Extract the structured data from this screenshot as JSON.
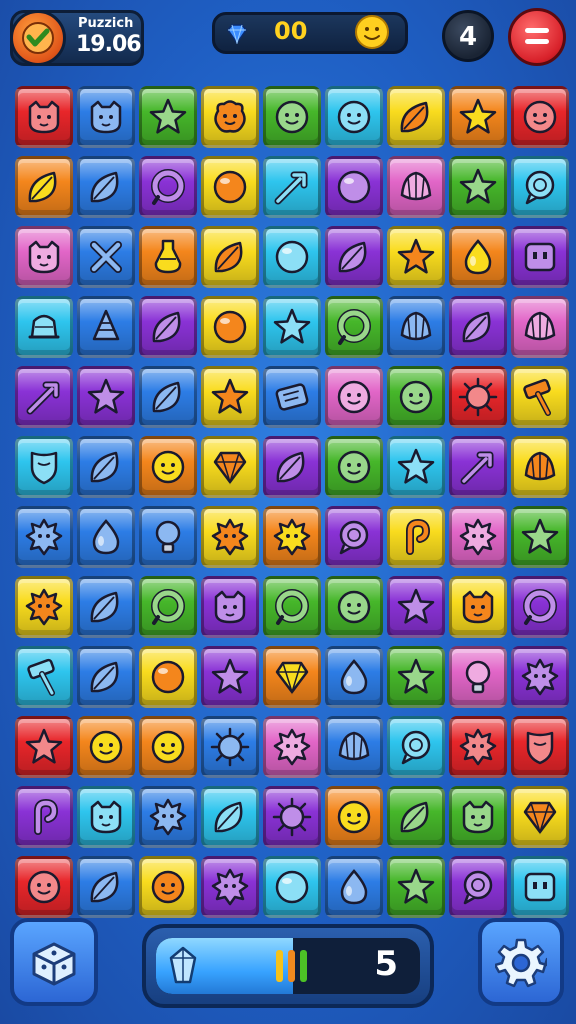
{
  "header": {
    "title": "Puzzich",
    "score": "19.06",
    "gems": "00",
    "lives": "4"
  },
  "footer": {
    "moves": "5",
    "progress": 0.52
  },
  "palette": {
    "red": "#e8262a",
    "orange": "#f4861c",
    "yellow": "#f9dc1e",
    "green": "#46b72a",
    "cyan": "#2ec5ee",
    "blue": "#2d7de6",
    "purple": "#8a32d6",
    "pink": "#e266c8"
  },
  "board": {
    "rows": [
      [
        [
          "red",
          "cat-face"
        ],
        [
          "blue",
          "cat-face"
        ],
        [
          "green",
          "star"
        ],
        [
          "yellow",
          "blob-face"
        ],
        [
          "green",
          "face"
        ],
        [
          "cyan",
          "face"
        ],
        [
          "yellow",
          "leaf"
        ],
        [
          "orange",
          "star"
        ],
        [
          "red",
          "face"
        ]
      ],
      [
        [
          "orange",
          "leaf"
        ],
        [
          "blue",
          "leaf"
        ],
        [
          "purple",
          "ring"
        ],
        [
          "yellow",
          "orb"
        ],
        [
          "cyan",
          "arrow"
        ],
        [
          "purple",
          "orb"
        ],
        [
          "pink",
          "shell"
        ],
        [
          "green",
          "star"
        ],
        [
          "cyan",
          "bubble"
        ]
      ],
      [
        [
          "pink",
          "cat-face"
        ],
        [
          "blue",
          "cross"
        ],
        [
          "orange",
          "potion"
        ],
        [
          "yellow",
          "leaf"
        ],
        [
          "cyan",
          "orb"
        ],
        [
          "purple",
          "leaf"
        ],
        [
          "yellow",
          "star"
        ],
        [
          "orange",
          "drop"
        ],
        [
          "purple",
          "cube"
        ]
      ],
      [
        [
          "cyan",
          "bell"
        ],
        [
          "blue",
          "cone"
        ],
        [
          "purple",
          "leaf"
        ],
        [
          "yellow",
          "orb"
        ],
        [
          "cyan",
          "star"
        ],
        [
          "green",
          "ring"
        ],
        [
          "blue",
          "shell"
        ],
        [
          "purple",
          "leaf"
        ],
        [
          "pink",
          "shell"
        ]
      ],
      [
        [
          "purple",
          "arrow"
        ],
        [
          "purple",
          "star"
        ],
        [
          "blue",
          "leaf"
        ],
        [
          "yellow",
          "star"
        ],
        [
          "blue",
          "scroll"
        ],
        [
          "pink",
          "face"
        ],
        [
          "green",
          "face"
        ],
        [
          "red",
          "sun"
        ],
        [
          "yellow",
          "hammer"
        ]
      ],
      [
        [
          "cyan",
          "shield"
        ],
        [
          "blue",
          "leaf"
        ],
        [
          "orange",
          "face"
        ],
        [
          "yellow",
          "gem"
        ],
        [
          "purple",
          "leaf"
        ],
        [
          "green",
          "face"
        ],
        [
          "cyan",
          "star"
        ],
        [
          "purple",
          "arrow"
        ],
        [
          "yellow",
          "shell"
        ]
      ],
      [
        [
          "blue",
          "spiky"
        ],
        [
          "blue",
          "drop"
        ],
        [
          "blue",
          "bulb"
        ],
        [
          "yellow",
          "spiky"
        ],
        [
          "orange",
          "spiky"
        ],
        [
          "purple",
          "bubble"
        ],
        [
          "yellow",
          "hook"
        ],
        [
          "pink",
          "spiky"
        ],
        [
          "green",
          "star"
        ]
      ],
      [
        [
          "yellow",
          "spiky"
        ],
        [
          "blue",
          "leaf"
        ],
        [
          "green",
          "ring"
        ],
        [
          "purple",
          "cat-face"
        ],
        [
          "green",
          "ring"
        ],
        [
          "green",
          "face"
        ],
        [
          "purple",
          "star"
        ],
        [
          "yellow",
          "cat-face"
        ],
        [
          "purple",
          "ring"
        ]
      ],
      [
        [
          "cyan",
          "hammer"
        ],
        [
          "blue",
          "leaf"
        ],
        [
          "yellow",
          "orb"
        ],
        [
          "purple",
          "star"
        ],
        [
          "orange",
          "gem"
        ],
        [
          "blue",
          "drop"
        ],
        [
          "green",
          "star"
        ],
        [
          "pink",
          "bulb"
        ],
        [
          "purple",
          "spiky"
        ]
      ],
      [
        [
          "red",
          "star"
        ],
        [
          "orange",
          "face"
        ],
        [
          "orange",
          "face"
        ],
        [
          "blue",
          "sun"
        ],
        [
          "pink",
          "spiky"
        ],
        [
          "blue",
          "shell"
        ],
        [
          "cyan",
          "bubble"
        ],
        [
          "red",
          "spiky"
        ],
        [
          "red",
          "shield"
        ]
      ],
      [
        [
          "purple",
          "hook"
        ],
        [
          "cyan",
          "cat-face"
        ],
        [
          "blue",
          "spiky"
        ],
        [
          "cyan",
          "leaf"
        ],
        [
          "purple",
          "sun"
        ],
        [
          "orange",
          "face"
        ],
        [
          "green",
          "leaf"
        ],
        [
          "green",
          "cat-face"
        ],
        [
          "yellow",
          "gem"
        ]
      ],
      [
        [
          "red",
          "face"
        ],
        [
          "blue",
          "leaf"
        ],
        [
          "yellow",
          "face"
        ],
        [
          "purple",
          "spiky"
        ],
        [
          "cyan",
          "orb"
        ],
        [
          "blue",
          "drop"
        ],
        [
          "green",
          "star"
        ],
        [
          "purple",
          "bubble"
        ],
        [
          "cyan",
          "cube"
        ]
      ]
    ]
  }
}
